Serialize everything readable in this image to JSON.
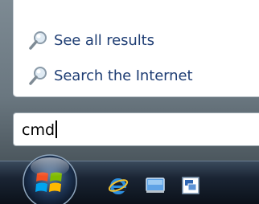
{
  "start_menu": {
    "results": [
      {
        "label": "See all results",
        "icon": "search-icon"
      },
      {
        "label": "Search the Internet",
        "icon": "search-icon"
      }
    ]
  },
  "search": {
    "value": "cmd"
  },
  "taskbar": {
    "start_button_icon": "windows-logo-icon",
    "quick_launch": [
      {
        "icon": "internet-explorer-icon"
      },
      {
        "icon": "show-desktop-icon"
      },
      {
        "icon": "switch-windows-icon"
      }
    ]
  },
  "colors": {
    "link_text": "#1f3e74",
    "taskbar": "#1a2433",
    "frame": "#6a7780"
  }
}
